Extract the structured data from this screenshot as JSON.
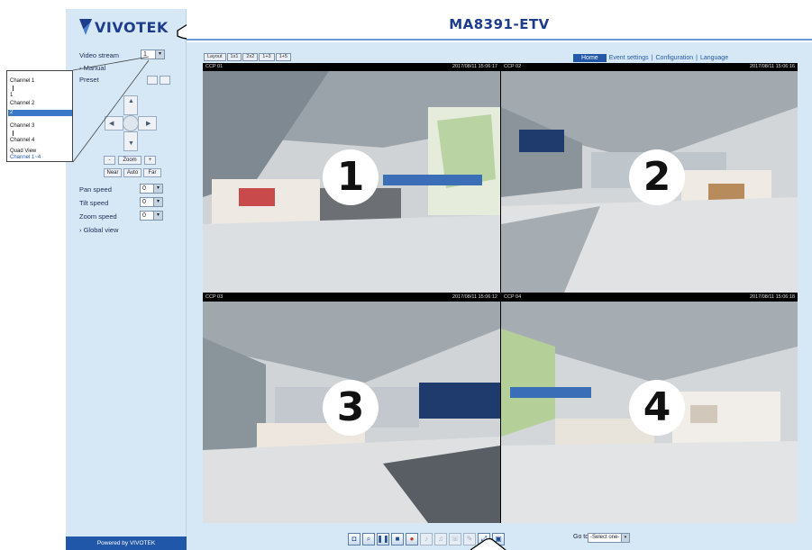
{
  "header": {
    "logo_text": "VIVOTEK",
    "title": "MA8391-ETV"
  },
  "nav": {
    "home": "Home",
    "links": [
      "Event settings",
      "Configuration",
      "Language"
    ]
  },
  "view_tabs": [
    "Layout",
    "1x1",
    "2x2",
    "1+3",
    "1+5"
  ],
  "sidebar": {
    "video_stream_label": "Video stream",
    "video_stream_value": "1",
    "manual_label": "Manual",
    "preset_label": "Preset",
    "pan_speed_label": "Pan speed",
    "pan_speed_value": "0",
    "tilt_speed_label": "Tilt speed",
    "tilt_speed_value": "0",
    "zoom_speed_label": "Zoom speed",
    "zoom_speed_value": "0",
    "global_view_label": "Global view",
    "zoom_buttons": [
      "-",
      "Zoom",
      "+"
    ],
    "focus_buttons": [
      "Near",
      "Auto",
      "Far"
    ],
    "powered_by": "Powered by VIVOTEK"
  },
  "popup": {
    "options": [
      "Channel 1",
      "1",
      "Channel 2",
      "2",
      "Channel 3",
      "3",
      "Channel 4",
      "4",
      "Quad View",
      "Channel 1~4"
    ],
    "selected_index": 3
  },
  "cameras": [
    {
      "label": "1",
      "left_caption": "CCP 01",
      "right_caption": "2017/08/11 15:06:17"
    },
    {
      "label": "2",
      "left_caption": "CCP 02",
      "right_caption": "2017/08/11 15:06:16"
    },
    {
      "label": "3",
      "left_caption": "CCP 03",
      "right_caption": "2017/08/11 15:06:12"
    },
    {
      "label": "4",
      "left_caption": "CCP 04",
      "right_caption": "2017/08/11 15:06:18"
    }
  ],
  "toolbar": {
    "icons": [
      "snapshot-icon",
      "digital-zoom-icon",
      "pause-icon",
      "stop-icon",
      "record-icon",
      "volume-icon",
      "mute-icon",
      "talk-icon",
      "mic-icon",
      "fullscreen-icon",
      "pip-icon"
    ],
    "goto_label": "Go to",
    "goto_select": "-Select one-"
  },
  "colors": {
    "brand": "#1e3c8c",
    "panel": "#d6e8f6",
    "accent": "#2458a8"
  }
}
